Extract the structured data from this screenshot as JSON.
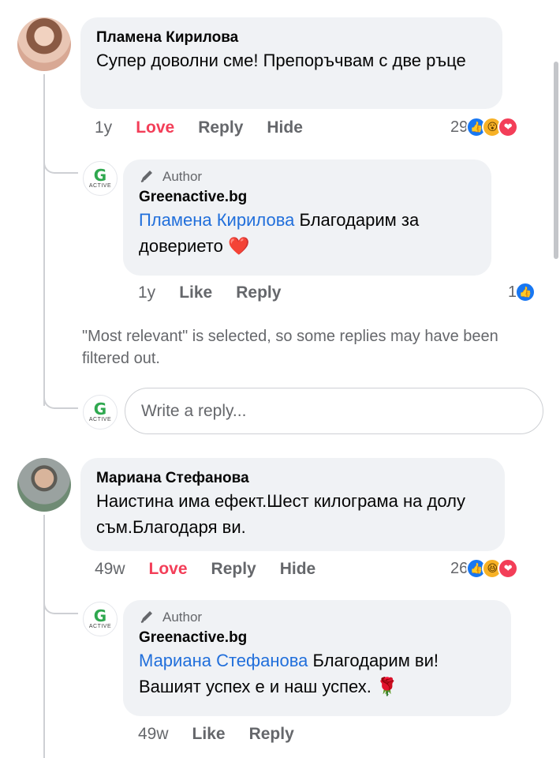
{
  "comments": [
    {
      "author": "Пламена Кирилова",
      "text": "Супер доволни сме! Препоръчвам с две ръце",
      "time": "1y",
      "reaction_label": "Love",
      "reply_label": "Reply",
      "hide_label": "Hide",
      "reaction_count": "29",
      "reactions": [
        "like-icon",
        "wow-icon",
        "love-icon"
      ],
      "reply": {
        "badge": "Author",
        "author": "Greenactive.bg",
        "mention": "Пламена Кирилова",
        "text": "Благодарим за доверието ❤️",
        "time": "1y",
        "like_label": "Like",
        "reply_label": "Reply",
        "reaction_count": "1",
        "reactions": [
          "like-icon"
        ]
      }
    },
    {
      "author": "Мариана Стефанова",
      "text": "Наистина има ефект.Шест килограма на долу съм.Благодаря ви.",
      "time": "49w",
      "reaction_label": "Love",
      "reply_label": "Reply",
      "hide_label": "Hide",
      "reaction_count": "26",
      "reactions": [
        "like-icon",
        "haha-icon",
        "love-icon"
      ],
      "reply": {
        "badge": "Author",
        "author": "Greenactive.bg",
        "mention": "Мариана Стефанова",
        "text": "Благодарим ви! Вашият успех е и наш успех. 🌹",
        "time": "49w",
        "like_label": "Like",
        "reply_label": "Reply"
      }
    }
  ],
  "notice": "\"Most relevant\" is selected, so some replies may have been filtered out.",
  "reply_box": {
    "placeholder": "Write a reply..."
  },
  "brand": {
    "logo_letter": "G",
    "logo_text": "ACTIVE",
    "accent": "#2fa84f"
  },
  "colors": {
    "link": "#216fdb",
    "love": "#f33e58",
    "muted": "#65676b",
    "bubble": "#f0f2f5"
  }
}
